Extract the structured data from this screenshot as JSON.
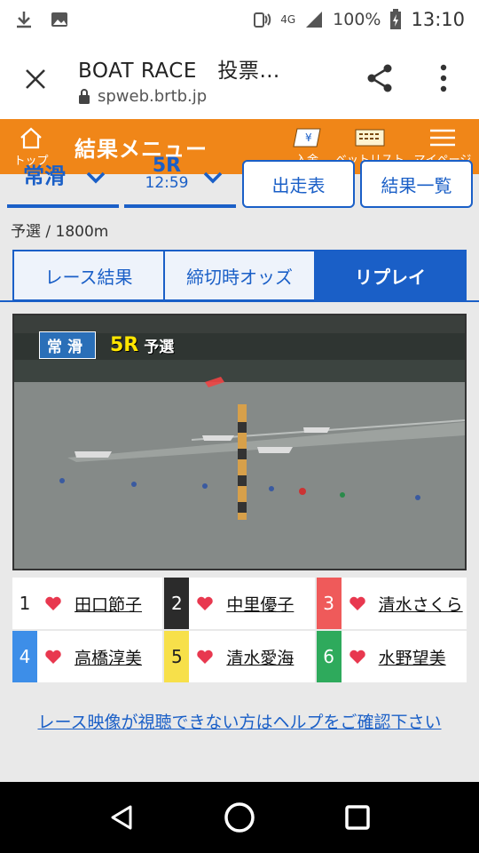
{
  "status_bar": {
    "network": "4G",
    "battery": "100%",
    "time": "13:10"
  },
  "browser": {
    "title": "BOAT RACE　投票…",
    "url": "spweb.brtb.jp"
  },
  "header": {
    "top_label": "トップ",
    "title": "結果メニュー",
    "actions": [
      {
        "label": "入金"
      },
      {
        "label": "ベットリスト"
      },
      {
        "label": "マイページ"
      }
    ]
  },
  "selector": {
    "venue": "常滑",
    "race": "5R",
    "time": "12:59",
    "entry_label": "出走表",
    "results_label": "結果一覧"
  },
  "race_info": "予選 / 1800m",
  "tabs": [
    {
      "label": "レース結果",
      "active": false
    },
    {
      "label": "締切時オッズ",
      "active": false
    },
    {
      "label": "リプレイ",
      "active": true
    }
  ],
  "video": {
    "caption_venue": "常滑",
    "caption_race": "5R",
    "caption_type": "予選"
  },
  "racers": [
    {
      "lane": "1",
      "name": "田口節子",
      "lane_bg": "#ffffff",
      "lane_fg": "#222222"
    },
    {
      "lane": "2",
      "name": "中里優子",
      "lane_bg": "#2b2b2b",
      "lane_fg": "#ffffff"
    },
    {
      "lane": "3",
      "name": "清水さくら",
      "lane_bg": "#ef5a5a",
      "lane_fg": "#ffffff"
    },
    {
      "lane": "4",
      "name": "高橋淳美",
      "lane_bg": "#3d8ee8",
      "lane_fg": "#ffffff"
    },
    {
      "lane": "5",
      "name": "清水愛海",
      "lane_bg": "#f7e04a",
      "lane_fg": "#222222"
    },
    {
      "lane": "6",
      "name": "水野望美",
      "lane_bg": "#2eaa5c",
      "lane_fg": "#ffffff"
    }
  ],
  "help_link": "レース映像が視聴できない方はヘルプをご確認下さい",
  "colors": {
    "brand_orange": "#f08618",
    "primary_blue": "#1a5fc7",
    "heart_red": "#e8384f"
  }
}
